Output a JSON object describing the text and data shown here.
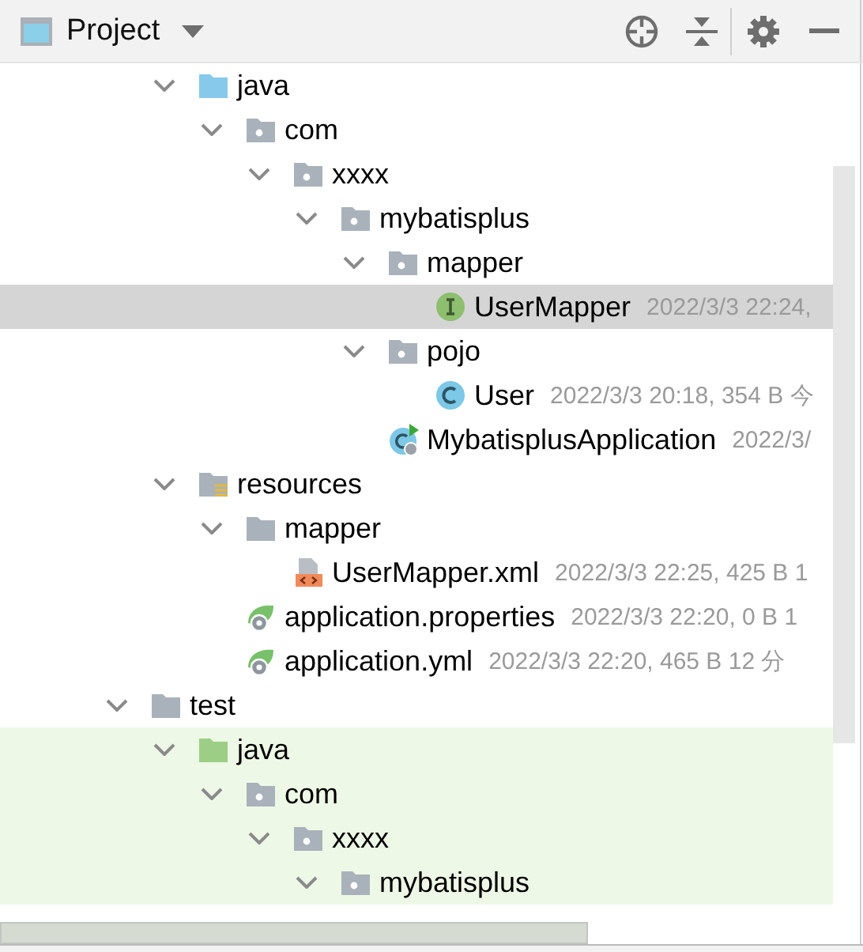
{
  "header": {
    "title": "Project"
  },
  "tree": [
    {
      "children": [
        {
          "label": "java",
          "kind": "source-folder",
          "expanded": true,
          "selected": false,
          "children": [
            {
              "label": "com",
              "kind": "package",
              "expanded": true,
              "selected": false,
              "children": [
                {
                  "label": "xxxx",
                  "kind": "package",
                  "expanded": true,
                  "selected": false,
                  "children": [
                    {
                      "label": "mybatisplus",
                      "kind": "package",
                      "expanded": true,
                      "selected": false,
                      "children": [
                        {
                          "label": "mapper",
                          "kind": "package",
                          "expanded": true,
                          "selected": false,
                          "children": [
                            {
                              "label": "UserMapper",
                              "kind": "interface",
                              "meta": "2022/3/3 22:24,",
                              "selected": true
                            }
                          ]
                        },
                        {
                          "label": "pojo",
                          "kind": "package",
                          "expanded": true,
                          "selected": false,
                          "children": [
                            {
                              "label": "User",
                              "kind": "class",
                              "meta": "2022/3/3 20:18, 354 B 今",
                              "selected": false
                            }
                          ]
                        },
                        {
                          "label": "MybatisplusApplication",
                          "kind": "app-class",
                          "meta": "2022/3/",
                          "selected": false
                        }
                      ]
                    }
                  ]
                }
              ]
            }
          ]
        },
        {
          "label": "resources",
          "kind": "resources-folder",
          "expanded": true,
          "selected": false,
          "children": [
            {
              "label": "mapper",
              "kind": "folder",
              "expanded": true,
              "selected": false,
              "children": [
                {
                  "label": "UserMapper.xml",
                  "kind": "xml",
                  "meta": "2022/3/3 22:25, 425 B 1",
                  "selected": false
                }
              ]
            },
            {
              "label": "application.properties",
              "kind": "spring-config",
              "meta": "2022/3/3 22:20, 0 B 1",
              "selected": false
            },
            {
              "label": "application.yml",
              "kind": "spring-config",
              "meta": "2022/3/3 22:20, 465 B 12 分",
              "selected": false
            }
          ]
        }
      ]
    },
    {
      "label": "test",
      "kind": "plain-folder",
      "expanded": true,
      "selected": false,
      "children": [
        {
          "label": "java",
          "kind": "test-folder",
          "expanded": true,
          "selected": false,
          "children": [
            {
              "label": "com",
              "kind": "package",
              "expanded": true,
              "selected": false,
              "children": [
                {
                  "label": "xxxx",
                  "kind": "package",
                  "expanded": true,
                  "selected": false,
                  "children": [
                    {
                      "label": "mybatisplus",
                      "kind": "package",
                      "expanded": true,
                      "selected": false
                    }
                  ]
                }
              ]
            }
          ]
        }
      ]
    }
  ]
}
